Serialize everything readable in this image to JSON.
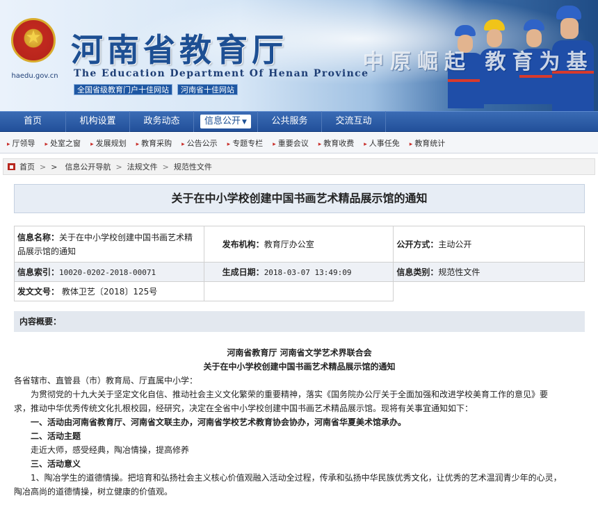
{
  "header": {
    "site_title": "河南省教育厅",
    "site_subtitle": "The Education Department Of Henan Province",
    "domain": "haedu.gov.cn",
    "badges": [
      "全国省级教育门户十佳网站",
      "河南省十佳网站"
    ],
    "slogan": "中原崛起 教育为基"
  },
  "main_nav": {
    "items": [
      "首页",
      "机构设置",
      "政务动态",
      "信息公开",
      "公共服务",
      "交流互动"
    ],
    "active_index": 3
  },
  "sub_nav": {
    "items": [
      "厅领导",
      "处室之窗",
      "发展规划",
      "教育采购",
      "公告公示",
      "专题专栏",
      "重要会议",
      "教育收费",
      "人事任免",
      "教育统计"
    ]
  },
  "breadcrumb": {
    "items": [
      "首页",
      ">",
      "信息公开导航",
      "法规文件",
      "规范性文件"
    ]
  },
  "article": {
    "title": "关于在中小学校创建中国书画艺术精品展示馆的通知",
    "meta": {
      "name_label": "信息名称：",
      "name_value": "关于在中小学校创建中国书画艺术精品展示馆的通知",
      "publisher_label": "发布机构：",
      "publisher_value": "教育厅办公室",
      "open_label": "公开方式：",
      "open_value": "主动公开",
      "index_label": "信息索引：",
      "index_value": "10020-0202-2018-00071",
      "date_label": "生成日期：",
      "date_value": "2018-03-07 13:49:09",
      "category_label": "信息类别：",
      "category_value": "规范性文件",
      "docno_label": "发文文号：",
      "docno_value": "教体卫艺〔2018〕125号"
    },
    "summary_label": "内容概要：",
    "body": {
      "issuers": "河南省教育厅 河南省文学艺术界联合会",
      "doc_title": "关于在中小学校创建中国书画艺术精品展示馆的通知",
      "salutation": "各省辖市、直管县（市）教育局、厅直属中小学：",
      "para1_a": "为贯彻党的十九大关于坚定文化自信、推动社会主义文化繁荣的重要精神，落实《国务院办公厅关于全面加强和改进学校美育工作的意见》要",
      "para1_b": "求，推动中华优秀传统文化扎根校园，经研究，决定在全省中小学校创建中国书画艺术精品展示馆。现将有关事宜通知如下：",
      "sec1": "一、活动由河南省教育厅、河南省文联主办，河南省学校艺术教育协会协办，河南省华夏美术馆承办。",
      "sec2": "二、活动主题",
      "sec2_text": "走近大师，感受经典，陶冶情操，提高修养",
      "sec3": "三、活动意义",
      "sec3_p1_a": "1、陶冶学生的道德情操。把培育和弘扬社会主义核心价值观融入活动全过程，传承和弘扬中华民族优秀文化，让优秀的艺术温润青少年的心灵，",
      "sec3_p1_b": "陶冶高尚的道德情操，树立健康的价值观。"
    }
  },
  "colors": {
    "nav_blue": "#22509a",
    "title_blue": "#1d4f93",
    "accent_red": "#c9302c"
  }
}
